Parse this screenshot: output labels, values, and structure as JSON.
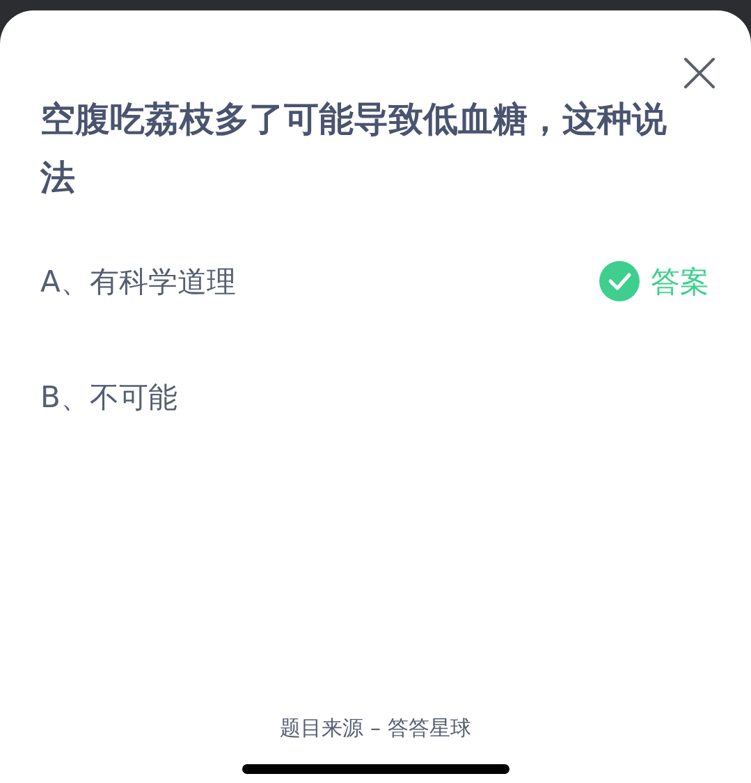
{
  "question": "空腹吃荔枝多了可能导致低血糖，这种说法",
  "options": [
    {
      "label": "A、有科学道理",
      "is_answer": true,
      "answer_label": "答案"
    },
    {
      "label": "B、不可能",
      "is_answer": false
    }
  ],
  "footer": "题目来源 – 答答星球"
}
